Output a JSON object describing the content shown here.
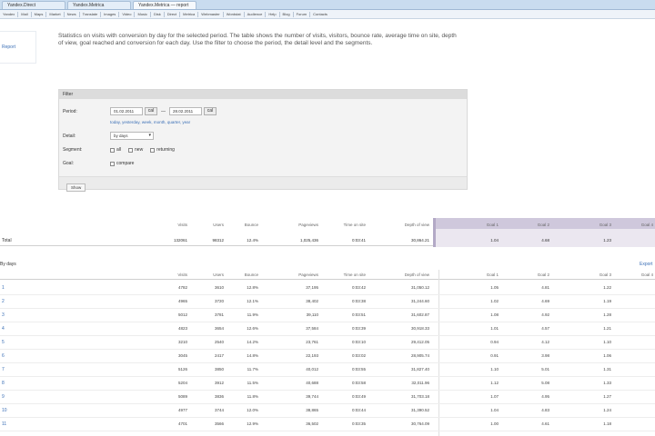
{
  "browser": {
    "tabs": [
      {
        "label": "Yandex.Direct",
        "active": false
      },
      {
        "label": "Yandex.Metrica",
        "active": false
      },
      {
        "label": "Yandex.Metrica — report",
        "active": true
      }
    ],
    "bookmarks": [
      "Yandex",
      "Mail",
      "Maps",
      "Market",
      "News",
      "Translate",
      "Images",
      "Video",
      "Music",
      "Disk",
      "Direct",
      "Metrica",
      "Webmaster",
      "Wordstat",
      "Audience",
      "Help",
      "Blog",
      "Forum",
      "Contacts"
    ]
  },
  "left_panel": {
    "label": "Report"
  },
  "description": "Statistics on visits with conversion by day for the selected period. The table shows the number of visits, visitors, bounce rate, average time on site, depth of view, goal reached and conversion for each day. Use the filter to choose the period, the detail level and the segments.",
  "filter": {
    "title": "Filter",
    "period_label": "Period:",
    "date_from": "01.02.2011",
    "date_to": "28.02.2011",
    "calendar_label": "cal",
    "quick_links": "today, yesterday, week, month, quarter, year",
    "detail_label": "Detail:",
    "detail_value": "by days",
    "segment_label": "Segment:",
    "segments": [
      "all",
      "new",
      "returning"
    ],
    "goal_label": "Goal:",
    "goal_option": "compare",
    "apply_label": "Show"
  },
  "summary": {
    "headers": [
      "Visits",
      "Users",
      "Bounce",
      "Pageviews",
      "Time on site",
      "Depth of view",
      "Goal 1",
      "Goal 2",
      "Goal 3",
      "Goal 4"
    ],
    "total_label": "Total",
    "values": [
      "132061",
      "98312",
      "12.4%",
      "1,025,436",
      "0:03:41",
      "30,864.21",
      "1.04",
      "4.68",
      "1.23",
      ""
    ]
  },
  "details": {
    "section_label": "By days",
    "export_link": "Export",
    "headers": [
      "Visits",
      "Users",
      "Bounce",
      "Pageviews",
      "Time on site",
      "Depth of view",
      "Goal 1",
      "Goal 2",
      "Goal 3",
      "Goal 4"
    ],
    "rows": [
      {
        "label": "1",
        "values": [
          "4782",
          "3610",
          "12.8%",
          "37,195",
          "0:03:42",
          "31,050.12",
          "1.05",
          "4.81",
          "1.22",
          ""
        ]
      },
      {
        "label": "2",
        "values": [
          "4965",
          "3720",
          "12.1%",
          "38,402",
          "0:03:38",
          "31,244.60",
          "1.02",
          "4.69",
          "1.19",
          ""
        ]
      },
      {
        "label": "3",
        "values": [
          "5012",
          "3781",
          "11.9%",
          "39,110",
          "0:03:51",
          "31,602.87",
          "1.08",
          "4.92",
          "1.28",
          ""
        ]
      },
      {
        "label": "4",
        "values": [
          "4823",
          "3654",
          "12.6%",
          "37,584",
          "0:03:39",
          "30,918.33",
          "1.01",
          "4.57",
          "1.21",
          ""
        ]
      },
      {
        "label": "5",
        "values": [
          "3210",
          "2540",
          "14.2%",
          "23,761",
          "0:03:10",
          "29,412.05",
          "0.94",
          "4.12",
          "1.10",
          ""
        ]
      },
      {
        "label": "6",
        "values": [
          "3045",
          "2417",
          "14.8%",
          "22,193",
          "0:03:02",
          "28,905.74",
          "0.91",
          "3.98",
          "1.06",
          ""
        ]
      },
      {
        "label": "7",
        "values": [
          "5126",
          "3850",
          "11.7%",
          "40,012",
          "0:03:55",
          "31,827.40",
          "1.10",
          "5.01",
          "1.31",
          ""
        ]
      },
      {
        "label": "8",
        "values": [
          "5204",
          "3912",
          "11.5%",
          "40,688",
          "0:03:58",
          "32,011.96",
          "1.12",
          "5.08",
          "1.33",
          ""
        ]
      },
      {
        "label": "9",
        "values": [
          "5089",
          "3836",
          "11.8%",
          "39,744",
          "0:03:49",
          "31,703.18",
          "1.07",
          "4.95",
          "1.27",
          ""
        ]
      },
      {
        "label": "10",
        "values": [
          "4977",
          "3744",
          "12.0%",
          "38,865",
          "0:03:44",
          "31,390.52",
          "1.04",
          "4.83",
          "1.24",
          ""
        ]
      },
      {
        "label": "11",
        "values": [
          "4701",
          "3566",
          "12.9%",
          "36,502",
          "0:03:35",
          "30,764.09",
          "1.00",
          "4.61",
          "1.18",
          ""
        ]
      }
    ]
  }
}
